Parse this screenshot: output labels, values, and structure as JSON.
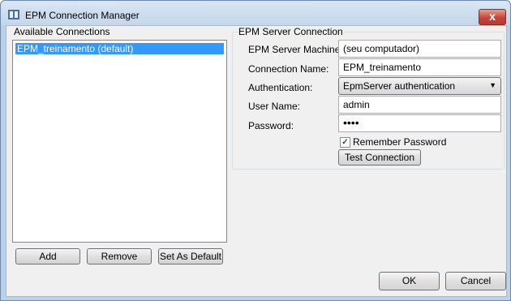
{
  "window": {
    "title": "EPM Connection Manager",
    "close_glyph": "x"
  },
  "available_connections": {
    "heading": "Available Connections",
    "items": [
      "EPM_treinamento (default)"
    ],
    "selected_index": 0,
    "buttons": {
      "add": "Add",
      "remove": "Remove",
      "set_default": "Set As Default"
    }
  },
  "server_connection": {
    "heading": "EPM Server Connection",
    "machine": {
      "label": "EPM Server Machine:",
      "value": "(seu computador)"
    },
    "name": {
      "label": "Connection Name:",
      "value": "EPM_treinamento"
    },
    "auth": {
      "label": "Authentication:",
      "value": "EpmServer authentication"
    },
    "user": {
      "label": "User Name:",
      "value": "admin"
    },
    "password": {
      "label": "Password:",
      "value": "••••"
    },
    "remember": {
      "label": "Remember Password",
      "checked": true
    },
    "test_button": "Test Connection"
  },
  "dialog_buttons": {
    "ok": "OK",
    "cancel": "Cancel"
  },
  "colors": {
    "selection": "#3399ff",
    "close": "#c7453a",
    "ok_border": "#3c7fb1"
  },
  "icons": {
    "app": "epm-app-icon",
    "close": "close-icon",
    "dropdown": "chevron-down-icon",
    "check": "checkmark-icon"
  }
}
